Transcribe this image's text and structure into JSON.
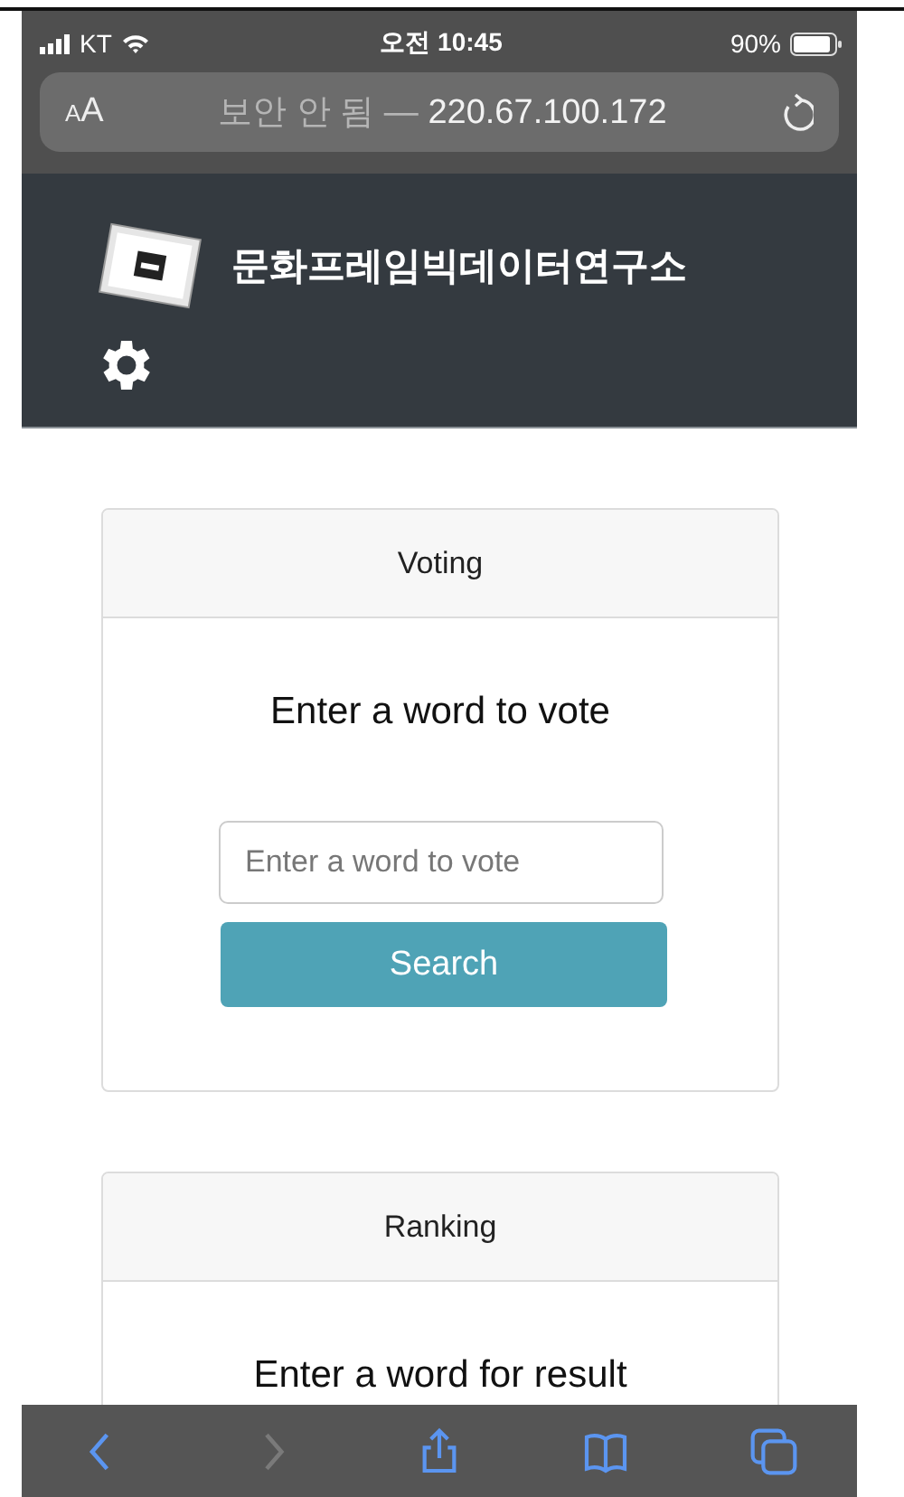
{
  "status_bar": {
    "carrier": "KT",
    "time": "오전 10:45",
    "battery": "90%"
  },
  "address_bar": {
    "text_size": "AA",
    "security": "보안 안 됨 —",
    "address": "220.67.100.172"
  },
  "header": {
    "title": "문화프레임빅데이터연구소"
  },
  "cards": [
    {
      "header": "Voting",
      "heading": "Enter a word to vote",
      "placeholder": "Enter a word to vote",
      "button": "Search"
    },
    {
      "header": "Ranking",
      "heading": "Enter a word for result"
    }
  ],
  "toolbar": [
    {
      "kind": "back",
      "disabled": false
    },
    {
      "kind": "forward",
      "disabled": true
    },
    {
      "kind": "share",
      "disabled": false
    },
    {
      "kind": "bookmarks",
      "disabled": false
    },
    {
      "kind": "tabs",
      "disabled": false
    }
  ]
}
